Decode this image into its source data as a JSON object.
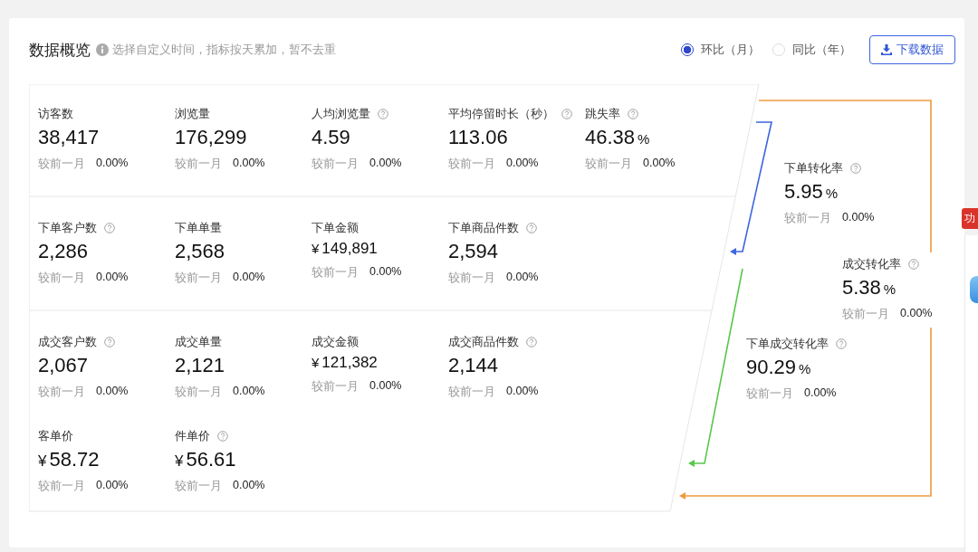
{
  "header": {
    "title": "数据概览",
    "hint": "选择自定义时间，指标按天累加，暂不去重",
    "comparison": [
      {
        "label": "环比（月）",
        "selected": true
      },
      {
        "label": "同比（年）",
        "selected": false
      }
    ],
    "download_button": "下载数据"
  },
  "sections": [
    {
      "rows": [
        [
          {
            "label": "访客数",
            "help": false,
            "value": "38,417",
            "compare_label": "较前一月",
            "compare_value": "0.00%"
          },
          {
            "label": "浏览量",
            "help": false,
            "value": "176,299",
            "compare_label": "较前一月",
            "compare_value": "0.00%"
          },
          {
            "label": "人均浏览量",
            "help": true,
            "value": "4.59",
            "compare_label": "较前一月",
            "compare_value": "0.00%"
          },
          {
            "label": "平均停留时长（秒）",
            "help": true,
            "value": "113.06",
            "compare_label": "较前一月",
            "compare_value": "0.00%"
          },
          {
            "label": "跳失率",
            "help": true,
            "value": "46.38",
            "unit": "%",
            "compare_label": "较前一月",
            "compare_value": "0.00%"
          }
        ]
      ]
    },
    {
      "rows": [
        [
          {
            "label": "下单客户数",
            "help": true,
            "value": "2,286",
            "compare_label": "较前一月",
            "compare_value": "0.00%"
          },
          {
            "label": "下单单量",
            "help": false,
            "value": "2,568",
            "compare_label": "较前一月",
            "compare_value": "0.00%"
          },
          {
            "label": "下单金额",
            "help": false,
            "currency": "¥",
            "value": "149,891",
            "compare_label": "较前一月",
            "compare_value": "0.00%"
          },
          {
            "label": "下单商品件数",
            "help": true,
            "value": "2,594",
            "compare_label": "较前一月",
            "compare_value": "0.00%"
          }
        ]
      ]
    },
    {
      "rows": [
        [
          {
            "label": "成交客户数",
            "help": true,
            "value": "2,067",
            "compare_label": "较前一月",
            "compare_value": "0.00%"
          },
          {
            "label": "成交单量",
            "help": false,
            "value": "2,121",
            "compare_label": "较前一月",
            "compare_value": "0.00%"
          },
          {
            "label": "成交金额",
            "help": false,
            "currency": "¥",
            "value": "121,382",
            "compare_label": "较前一月",
            "compare_value": "0.00%"
          },
          {
            "label": "成交商品件数",
            "help": true,
            "value": "2,144",
            "compare_label": "较前一月",
            "compare_value": "0.00%"
          }
        ],
        [
          {
            "label": "客单价",
            "help": false,
            "currency": "¥",
            "value": "58.72",
            "big_currency": true,
            "compare_label": "较前一月",
            "compare_value": "0.00%"
          },
          {
            "label": "件单价",
            "help": true,
            "currency": "¥",
            "value": "56.61",
            "big_currency": true,
            "compare_label": "较前一月",
            "compare_value": "0.00%"
          }
        ]
      ]
    }
  ],
  "conversions": [
    {
      "label": "下单转化率",
      "help": true,
      "value": "5.95",
      "unit": "%",
      "compare_label": "较前一月",
      "compare_value": "0.00%"
    },
    {
      "label": "成交转化率",
      "help": true,
      "value": "5.38",
      "unit": "%",
      "compare_label": "较前一月",
      "compare_value": "0.00%"
    },
    {
      "label": "下单成交转化率",
      "help": true,
      "value": "90.29",
      "unit": "%",
      "compare_label": "较前一月",
      "compare_value": "0.00%"
    }
  ],
  "side_badge": "功"
}
